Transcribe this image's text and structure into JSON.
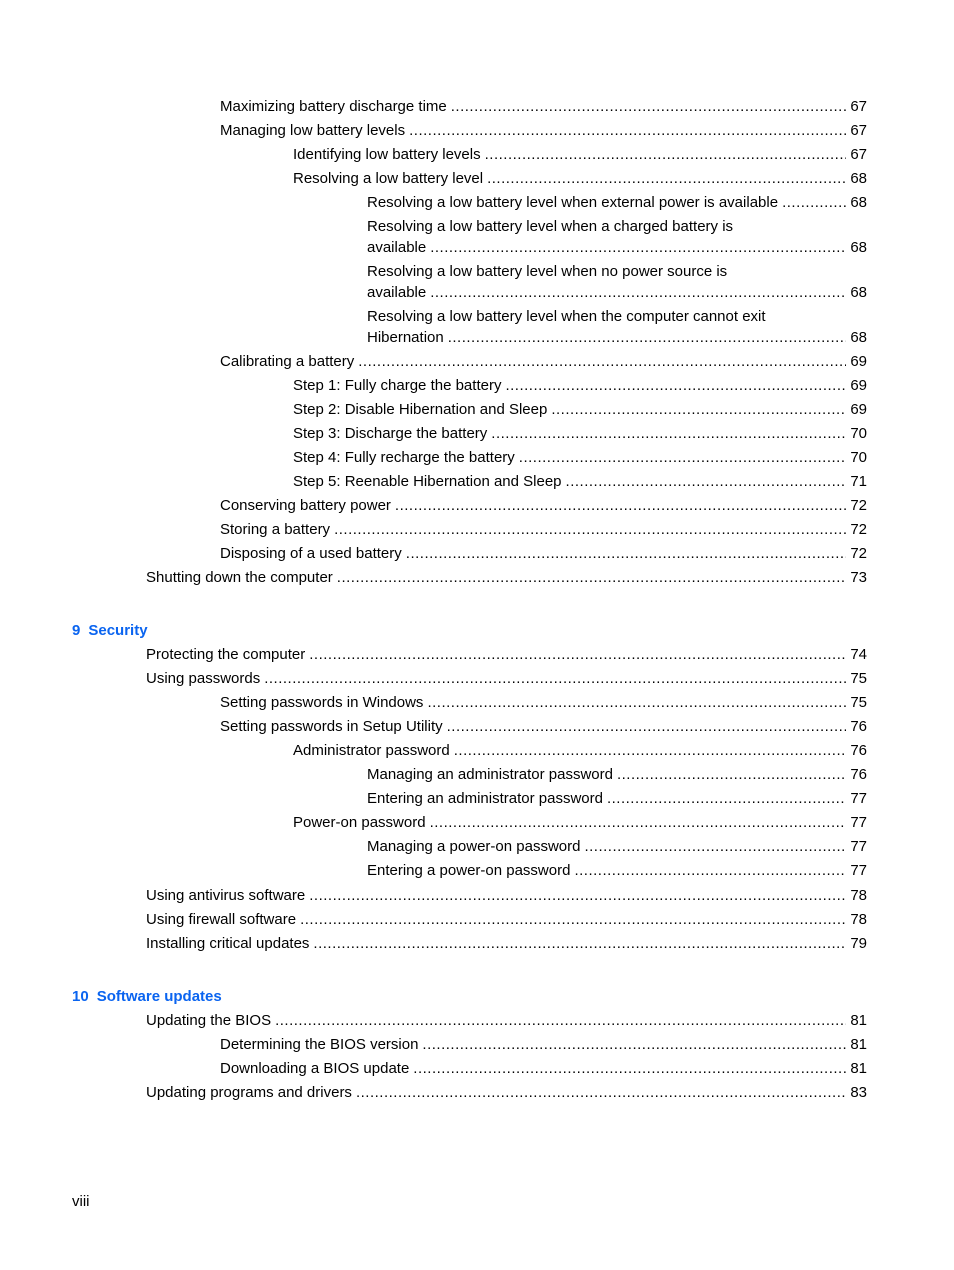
{
  "colors": {
    "chapter_heading": "#0a64f0",
    "text": "#000000"
  },
  "entries_a": [
    {
      "title": "Maximizing battery discharge time",
      "page": "67",
      "level": 2
    },
    {
      "title": "Managing low battery levels",
      "page": "67",
      "level": 2
    },
    {
      "title": "Identifying low battery levels",
      "page": "67",
      "level": 3
    },
    {
      "title": "Resolving a low battery level",
      "page": "68",
      "level": 3
    },
    {
      "title": "Resolving a low battery level when external power is available",
      "page": "68",
      "level": 4
    },
    {
      "title_line1": "Resolving a low battery level when a charged battery is",
      "title": "available",
      "page": "68",
      "level": 4
    },
    {
      "title_line1": "Resolving a low battery level when no power source is",
      "title": "available",
      "page": "68",
      "level": 4
    },
    {
      "title_line1": "Resolving a low battery level when the computer cannot exit",
      "title": "Hibernation",
      "page": "68",
      "level": 4
    },
    {
      "title": "Calibrating a battery",
      "page": "69",
      "level": 2
    },
    {
      "title": "Step 1: Fully charge the battery",
      "page": "69",
      "level": 3
    },
    {
      "title": "Step 2: Disable Hibernation and Sleep",
      "page": "69",
      "level": 3
    },
    {
      "title": "Step 3: Discharge the battery",
      "page": "70",
      "level": 3
    },
    {
      "title": "Step 4: Fully recharge the battery",
      "page": "70",
      "level": 3
    },
    {
      "title": "Step 5: Reenable Hibernation and Sleep",
      "page": "71",
      "level": 3
    },
    {
      "title": "Conserving battery power",
      "page": "72",
      "level": 2
    },
    {
      "title": "Storing a battery",
      "page": "72",
      "level": 2
    },
    {
      "title": "Disposing of a used battery",
      "page": "72",
      "level": 2
    },
    {
      "title": "Shutting down the computer",
      "page": "73",
      "level": 1
    }
  ],
  "chapter9": {
    "number": "9",
    "title": "Security",
    "entries": [
      {
        "title": "Protecting the computer",
        "page": "74",
        "level": 1
      },
      {
        "title": "Using passwords",
        "page": "75",
        "level": 1
      },
      {
        "title": "Setting passwords in Windows",
        "page": "75",
        "level": 2
      },
      {
        "title": "Setting passwords in Setup Utility",
        "page": "76",
        "level": 2
      },
      {
        "title": "Administrator password",
        "page": "76",
        "level": 3
      },
      {
        "title": "Managing an administrator password",
        "page": "76",
        "level": 4
      },
      {
        "title": "Entering an administrator password",
        "page": "77",
        "level": 4
      },
      {
        "title": "Power-on password",
        "page": "77",
        "level": 3
      },
      {
        "title": "Managing a power-on password",
        "page": "77",
        "level": 4
      },
      {
        "title": "Entering a power-on password",
        "page": "77",
        "level": 4
      },
      {
        "title": "Using antivirus software",
        "page": "78",
        "level": 1
      },
      {
        "title": "Using firewall software",
        "page": "78",
        "level": 1
      },
      {
        "title": "Installing critical updates",
        "page": "79",
        "level": 1
      }
    ]
  },
  "chapter10": {
    "number": "10",
    "title": "Software updates",
    "entries": [
      {
        "title": "Updating the BIOS",
        "page": "81",
        "level": 1
      },
      {
        "title": "Determining the BIOS version",
        "page": "81",
        "level": 2
      },
      {
        "title": "Downloading a BIOS update",
        "page": "81",
        "level": 2
      },
      {
        "title": "Updating programs and drivers",
        "page": "83",
        "level": 1
      }
    ]
  },
  "footer": {
    "page_number": "viii"
  }
}
